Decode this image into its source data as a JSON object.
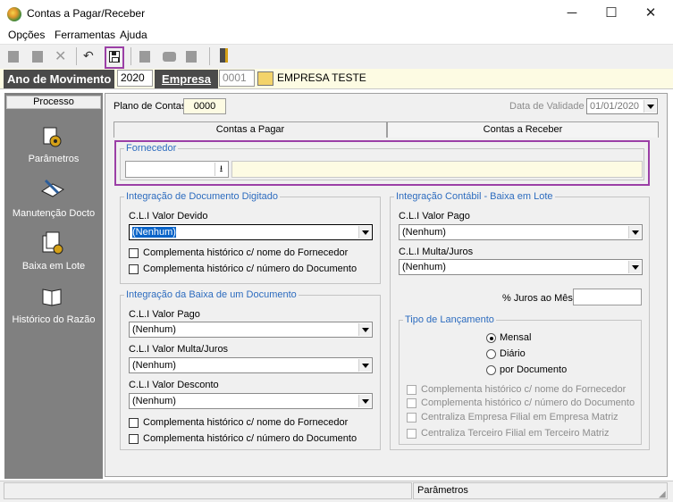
{
  "window": {
    "title": "Contas a Pagar/Receber",
    "minimize": "─",
    "maximize": "☐",
    "close": "✕"
  },
  "menu": [
    "Opções",
    "Ferramentas",
    "Ajuda"
  ],
  "toolbar": {
    "icons": [
      "new-doc-icon",
      "edit-doc-icon",
      "delete-icon",
      "undo-icon",
      "save-icon",
      "doc-icon",
      "print-icon",
      "report-icon",
      "exit-door-icon"
    ]
  },
  "yearbar": {
    "ano_label": "Ano de Movimento",
    "ano_value": "2020",
    "empresa_label": "Empresa",
    "empresa_code": "0001",
    "empresa_name": "EMPRESA TESTE"
  },
  "sidebar": {
    "header": "Processo",
    "items": [
      "Parâmetros",
      "Manutenção Docto",
      "Baixa em Lote",
      "Histórico do Razão"
    ]
  },
  "plano": {
    "label": "Plano de Contas",
    "value": "0000",
    "validade_label": "Data de Validade",
    "validade_value": "01/01/2020"
  },
  "tabs": [
    "Contas a Pagar",
    "Contas a Receber"
  ],
  "fornecedor": {
    "title": "Fornecedor",
    "code": "",
    "name": ""
  },
  "integ_doc": {
    "title": "Integração de Documento Digitado",
    "cli_label": "C.L.I Valor Devido",
    "cli_value": "(Nenhum)",
    "chk1": "Complementa histórico c/ nome do Fornecedor",
    "chk2": "Complementa histórico c/ número do Documento"
  },
  "integ_baixa": {
    "title": "Integração da Baixa de um Documento",
    "pago_label": "C.L.I Valor Pago",
    "pago_value": "(Nenhum)",
    "multa_label": "C.L.I Valor Multa/Juros",
    "multa_value": "(Nenhum)",
    "desc_label": "C.L.I Valor Desconto",
    "desc_value": "(Nenhum)",
    "chk1": "Complementa histórico c/ nome do Fornecedor",
    "chk2": "Complementa histórico c/ número do Documento"
  },
  "integ_lote": {
    "title": "Integração Contábil - Baixa em Lote",
    "pago_label": "C.L.I Valor Pago",
    "pago_value": "(Nenhum)",
    "multa_label": "C.L.I Multa/Juros",
    "multa_value": "(Nenhum)",
    "juros_label": "% Juros ao Mês",
    "juros_value": ""
  },
  "tipo_lanc": {
    "title": "Tipo de Lançamento",
    "options": [
      "Mensal",
      "Diário",
      "por Documento"
    ],
    "selected": "Mensal",
    "checks": [
      "Complementa histórico c/ nome do Fornecedor",
      "Complementa histórico c/ número do Documento",
      "Centraliza Empresa Filial em Empresa Matriz",
      "Centraliza Terceiro Filial em Terceiro Matriz"
    ]
  },
  "status": {
    "text": "Parâmetros"
  }
}
